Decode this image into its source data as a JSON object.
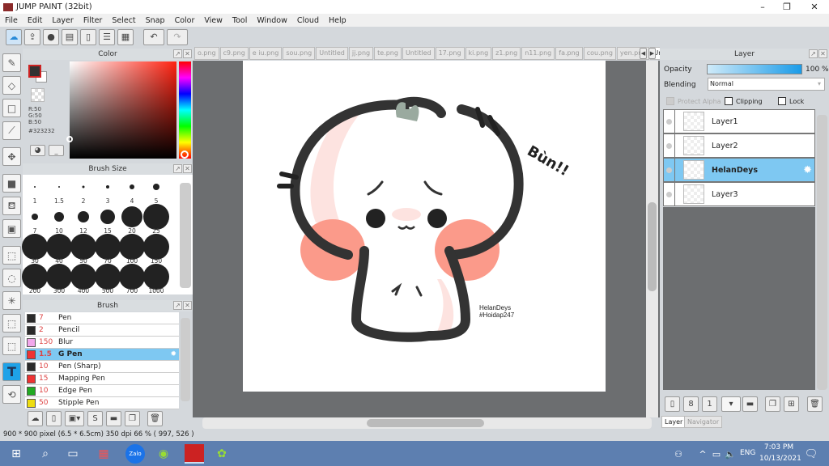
{
  "window": {
    "title": "JUMP PAINT (32bit)"
  },
  "menu": [
    "File",
    "Edit",
    "Layer",
    "Filter",
    "Select",
    "Snap",
    "Color",
    "View",
    "Tool",
    "Window",
    "Cloud",
    "Help"
  ],
  "toolbar": {
    "icons": [
      "cloud-icon",
      "share-icon",
      "speech-bubble-icon",
      "comment-icon",
      "page-icon",
      "layout-icon",
      "panels-icon"
    ],
    "undo": "undo-icon",
    "redo": "redo-icon"
  },
  "tabs": [
    "o.png",
    "c9.png",
    "e iu.png",
    "sou.png",
    "Untitled",
    "jj.png",
    "te.png",
    "Untitled",
    "17.png",
    "ki.png",
    "z1.png",
    "n11.png",
    "fa.png",
    "cou.png",
    "yen.png",
    "Untitled"
  ],
  "active_tab_index": 15,
  "color_panel": {
    "title": "Color",
    "r": "R:50",
    "g": "G:50",
    "b": "B:50",
    "hex": "#323232",
    "fg_color": "#323232",
    "bg_color": "#ffffff"
  },
  "brush_size_panel": {
    "title": "Brush Size",
    "sizes": [
      "1",
      "1.5",
      "2",
      "3",
      "4",
      "5",
      "7",
      "10",
      "12",
      "15",
      "20",
      "25",
      "30",
      "40",
      "50",
      "70",
      "100",
      "150",
      "200",
      "300",
      "400",
      "500",
      "700",
      "1000"
    ]
  },
  "brush_panel": {
    "title": "Brush",
    "items": [
      {
        "size": "7",
        "name": "Pen",
        "color": "#2a2a2a"
      },
      {
        "size": "2",
        "name": "Pencil",
        "color": "#2a2a2a"
      },
      {
        "size": "150",
        "name": "Blur",
        "color": "#f2a8ec"
      },
      {
        "size": "1.5",
        "name": "G Pen",
        "color": "#ee3333",
        "selected": true
      },
      {
        "size": "10",
        "name": "Pen (Sharp)",
        "color": "#2a2a2a"
      },
      {
        "size": "15",
        "name": "Mapping Pen",
        "color": "#ee3333"
      },
      {
        "size": "10",
        "name": "Edge Pen",
        "color": "#22aa22"
      },
      {
        "size": "50",
        "name": "Stipple Pen",
        "color": "#eedd11"
      }
    ]
  },
  "canvas": {
    "text1": "Bùn!!",
    "signature1": "HelanDeys",
    "signature2": "#Hoidap247"
  },
  "layer_panel": {
    "title": "Layer",
    "opacity_label": "Opacity",
    "opacity_value": "100 %",
    "opacity": 100,
    "blending_label": "Blending",
    "blending_value": "Normal",
    "protect_alpha": "Protect Alpha",
    "clipping": "Clipping",
    "lock": "Lock",
    "layers": [
      {
        "name": "Layer1"
      },
      {
        "name": "Layer2"
      },
      {
        "name": "HelanDeys",
        "selected": true
      },
      {
        "name": "Layer3"
      }
    ],
    "tabs": [
      "Layer",
      "Navigator"
    ]
  },
  "status": {
    "text": "900 * 900 pixel   (6.5 * 6.5cm)   350 dpi   66 %   ( 997, 526 )"
  },
  "taskbar": {
    "lang": "ENG",
    "time": "7:03 PM",
    "date": "10/13/2021"
  }
}
